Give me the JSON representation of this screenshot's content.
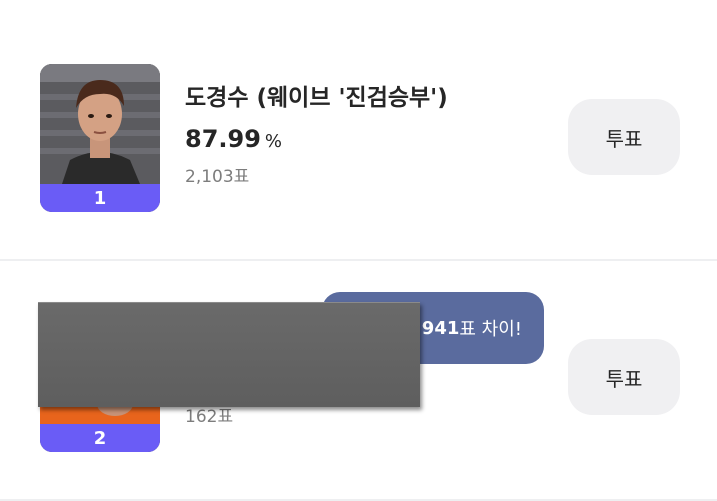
{
  "ranking": [
    {
      "rank": "1",
      "name": "도경수 (웨이브 '진검승부')",
      "percent": "87.99",
      "percent_unit": "%",
      "votes": "2,103표",
      "vote_button": "투표"
    },
    {
      "rank": "2",
      "votes": "162표",
      "vote_button": "투표",
      "gap_value": "941",
      "gap_suffix": "표 차이!"
    }
  ],
  "colors": {
    "rank_badge": "#6a5cf6",
    "gap_bubble": "#5a6b9e",
    "vote_button_bg": "#f0f0f2",
    "redaction": "#636363"
  }
}
